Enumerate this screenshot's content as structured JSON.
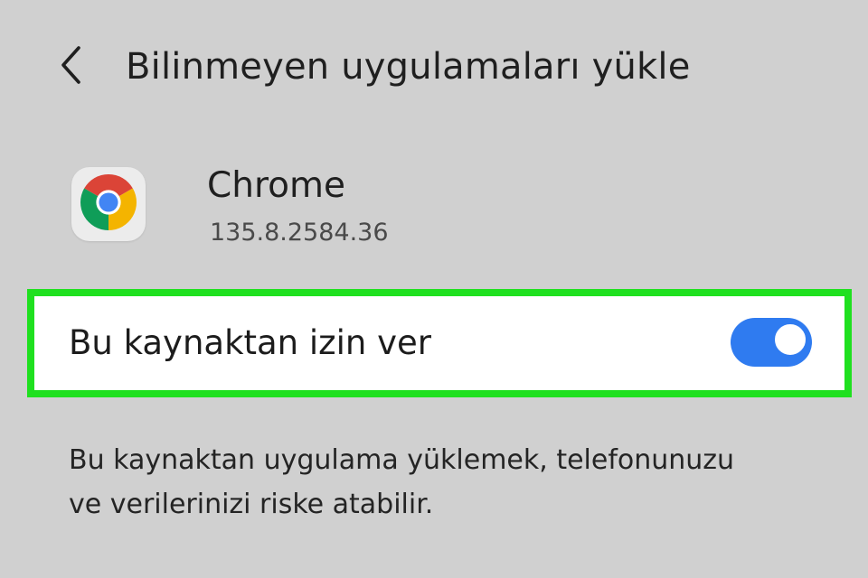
{
  "header": {
    "title": "Bilinmeyen uygulamaları yükle",
    "back_icon": "chevron-left-icon"
  },
  "app": {
    "name": "Chrome",
    "version": "135.8.2584.36",
    "icon": "chrome-icon"
  },
  "setting": {
    "label": "Bu kaynaktan izin ver",
    "enabled": true,
    "highlight_color": "#1fe01f",
    "toggle_color": "#2f7bf0"
  },
  "warning": {
    "line1": "Bu kaynaktan uygulama yüklemek, telefonunuzu",
    "line2": "ve verilerinizi riske atabilir."
  },
  "colors": {
    "background": "#d0d0d0",
    "card": "#ffffff"
  }
}
